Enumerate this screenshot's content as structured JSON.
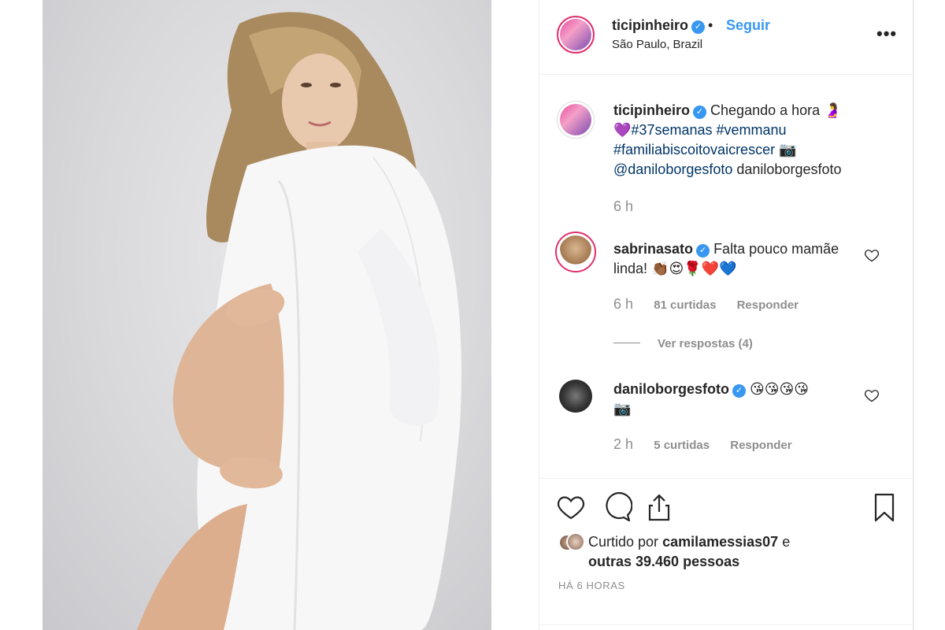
{
  "post": {
    "author": "ticipinheiro",
    "location": "São Paulo, Brazil",
    "follow_label": "Seguir",
    "separator": "•",
    "more_label": "•••"
  },
  "caption": {
    "user": "ticipinheiro",
    "text": "Chegando a hora",
    "emoji_1": "🤰",
    "emoji_2": "💜",
    "tag_1": "#37semanas",
    "tag_2": "#vemmanu",
    "tag_3": "#familiabiscoitovaicrescer",
    "emoji_3": "📷",
    "mention": "@daniloborgesfoto",
    "trailing": "daniloborgesfoto",
    "time": "6 h"
  },
  "comments": [
    {
      "user": "sabrinasato",
      "text": "Falta pouco mamãe linda!",
      "emojis": "👏🏾😍🌹❤️💙",
      "time": "6 h",
      "likes": "81 curtidas",
      "reply_label": "Responder",
      "view_replies": "Ver respostas (4)"
    },
    {
      "user": "daniloborgesfoto",
      "emojis": "😘😘😘😘",
      "emoji_extra": "📷",
      "time": "2 h",
      "likes": "5 curtidas",
      "reply_label": "Responder"
    }
  ],
  "footer": {
    "liked_prefix": "Curtido por",
    "liked_user": "camilamessias07",
    "liked_conj": "e",
    "liked_others": "outras 39.460 pessoas",
    "time_ago": "HÁ 6 HORAS"
  },
  "icons": {
    "like": "heart-icon",
    "comment": "comment-icon",
    "share": "share-icon",
    "save": "bookmark-icon",
    "verified": "verified-badge-icon",
    "more": "more-options-icon"
  },
  "colors": {
    "link_blue": "#3897f0",
    "hashtag": "#003569",
    "muted": "#8e8e8e",
    "text": "#262626",
    "story_ring": "#e1306c"
  }
}
